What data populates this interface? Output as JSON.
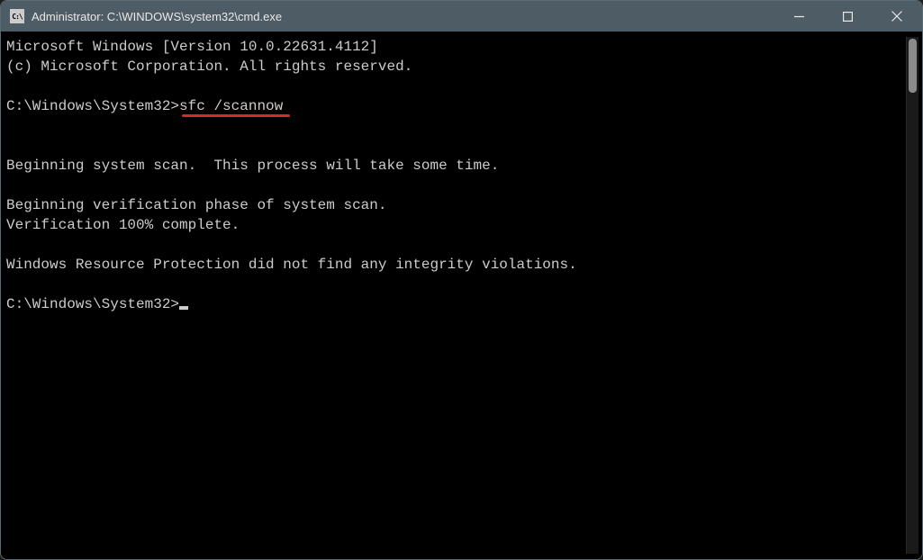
{
  "titlebar": {
    "icon_text": "C:\\",
    "title": "Administrator: C:\\WINDOWS\\system32\\cmd.exe",
    "minimize_label": "Minimize",
    "maximize_label": "Maximize",
    "close_label": "Close"
  },
  "terminal": {
    "line1": "Microsoft Windows [Version 10.0.22631.4112]",
    "line2": "(c) Microsoft Corporation. All rights reserved.",
    "blank": "",
    "prompt1_path": "C:\\Windows\\System32>",
    "prompt1_cmd": "sfc /scannow",
    "line_scan": "Beginning system scan.  This process will take some time.",
    "line_verif1": "Beginning verification phase of system scan.",
    "line_verif2": "Verification 100% complete.",
    "line_result": "Windows Resource Protection did not find any integrity violations.",
    "prompt2_path": "C:\\Windows\\System32>"
  },
  "annotation": {
    "underline_color": "#d12c2c"
  }
}
